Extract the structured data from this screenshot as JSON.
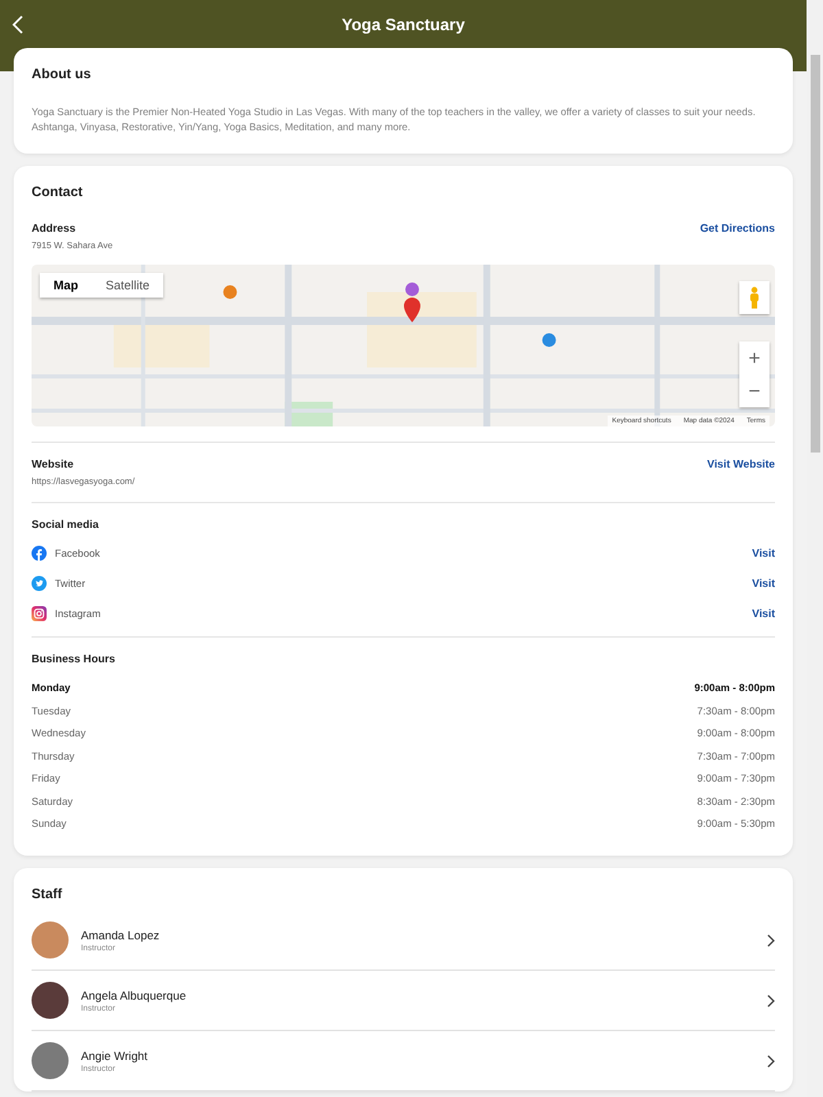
{
  "header": {
    "title": "Yoga Sanctuary"
  },
  "about": {
    "heading": "About us",
    "text": "Yoga Sanctuary is the Premier Non-Heated Yoga Studio in Las Vegas. With many of the top teachers in the valley, we offer a variety of classes to suit your needs. Ashtanga, Vinyasa, Restorative, Yin/Yang, Yoga Basics, Meditation, and many more."
  },
  "contact": {
    "heading": "Contact",
    "address": {
      "label": "Address",
      "value": "7915 W. Sahara Ave",
      "action": "Get Directions"
    },
    "map": {
      "kind": "picture",
      "map_types": [
        {
          "label": "Map",
          "selected": true
        },
        {
          "label": "Satellite",
          "selected": false
        }
      ],
      "zoom_in": "+",
      "zoom_out": "−",
      "footer": [
        "Keyboard shortcuts",
        "Map data ©2024",
        "Terms"
      ]
    },
    "website": {
      "label": "Website",
      "value": "https://lasvegasyoga.com/",
      "action": "Visit Website"
    },
    "social": {
      "heading": "Social media",
      "items": [
        {
          "kind": "facebook",
          "name": "Facebook",
          "action": "Visit"
        },
        {
          "kind": "twitter",
          "name": "Twitter",
          "action": "Visit"
        },
        {
          "kind": "instagram",
          "name": "Instagram",
          "action": "Visit"
        }
      ]
    },
    "hours": {
      "heading": "Business Hours",
      "days": [
        {
          "day": "Monday",
          "time": "9:00am - 8:00pm",
          "today": true
        },
        {
          "day": "Tuesday",
          "time": "7:30am - 8:00pm",
          "today": false
        },
        {
          "day": "Wednesday",
          "time": "9:00am - 8:00pm",
          "today": false
        },
        {
          "day": "Thursday",
          "time": "7:30am - 7:00pm",
          "today": false
        },
        {
          "day": "Friday",
          "time": "9:00am - 7:30pm",
          "today": false
        },
        {
          "day": "Saturday",
          "time": "8:30am - 2:30pm",
          "today": false
        },
        {
          "day": "Sunday",
          "time": "9:00am - 5:30pm",
          "today": false
        }
      ]
    }
  },
  "staff": {
    "heading": "Staff",
    "members": [
      {
        "name": "Amanda Lopez",
        "role": "Instructor",
        "color": "#c98a5e"
      },
      {
        "name": "Angela Albuquerque",
        "role": "Instructor",
        "color": "#5a3b3a"
      },
      {
        "name": "Angie Wright",
        "role": "Instructor",
        "color": "#7a7a7a"
      }
    ]
  }
}
